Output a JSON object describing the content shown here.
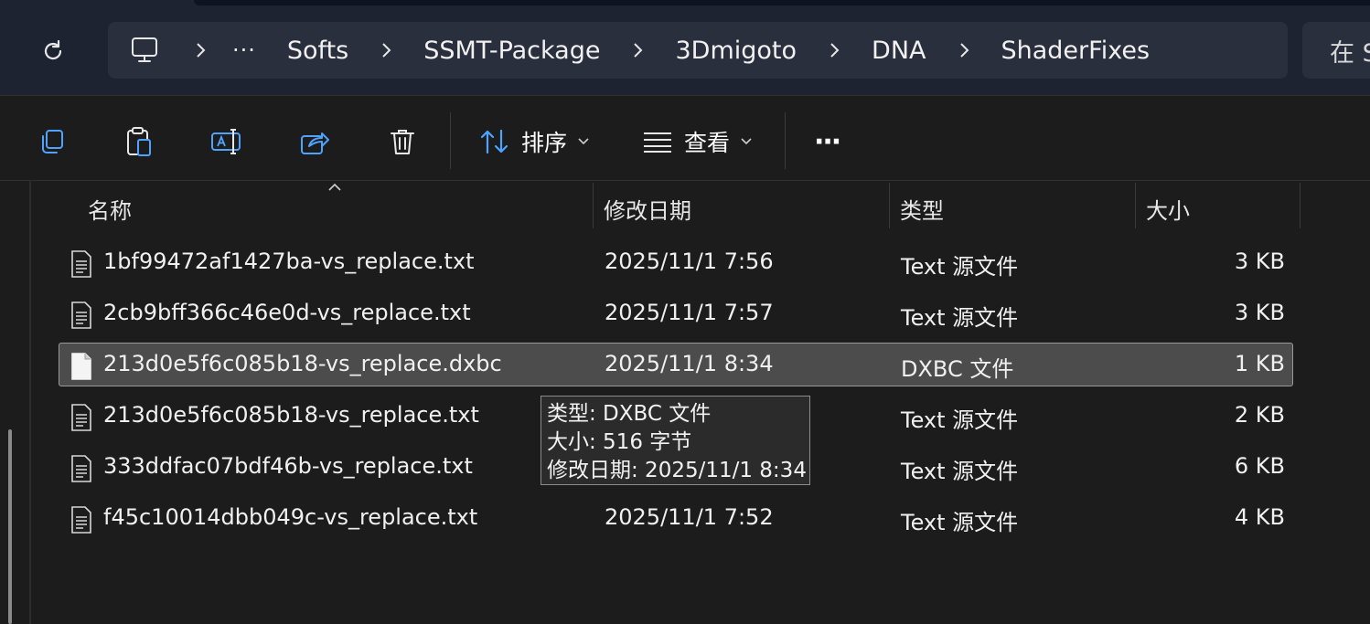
{
  "address_bar": {
    "crumbs": [
      "···",
      "Softs",
      "SSMT-Package",
      "3Dmigoto",
      "DNA",
      "ShaderFixes"
    ],
    "search_placeholder": "在 S"
  },
  "toolbar": {
    "sort_label": "排序",
    "view_label": "查看",
    "more_label": "···"
  },
  "columns": {
    "name": "名称",
    "date": "修改日期",
    "type": "类型",
    "size": "大小"
  },
  "files": [
    {
      "name": "1bf99472af1427ba-vs_replace.txt",
      "date": "2025/11/1 7:56",
      "type": "Text 源文件",
      "size": "3 KB"
    },
    {
      "name": "2cb9bff366c46e0d-vs_replace.txt",
      "date": "2025/11/1 7:57",
      "type": "Text 源文件",
      "size": "3 KB"
    },
    {
      "name": "213d0e5f6c085b18-vs_replace.dxbc",
      "date": "2025/11/1 8:34",
      "type": "DXBC 文件",
      "size": "1 KB"
    },
    {
      "name": "213d0e5f6c085b18-vs_replace.txt",
      "date": "",
      "type": "Text 源文件",
      "size": "2 KB"
    },
    {
      "name": "333ddfac07bdf46b-vs_replace.txt",
      "date": "",
      "type": "Text 源文件",
      "size": "6 KB"
    },
    {
      "name": "f45c10014dbb049c-vs_replace.txt",
      "date": "2025/11/1 7:52",
      "type": "Text 源文件",
      "size": "4 KB"
    }
  ],
  "tooltip": {
    "type_line": "类型: DXBC 文件",
    "size_line": "大小: 516 字节",
    "date_line": "修改日期: 2025/11/1 8:34"
  },
  "colors": {
    "accent": "#4fa3ff",
    "selection": "#4c4c4c",
    "background": "#1c1c1c",
    "address_bg": "#2a2f3d"
  }
}
